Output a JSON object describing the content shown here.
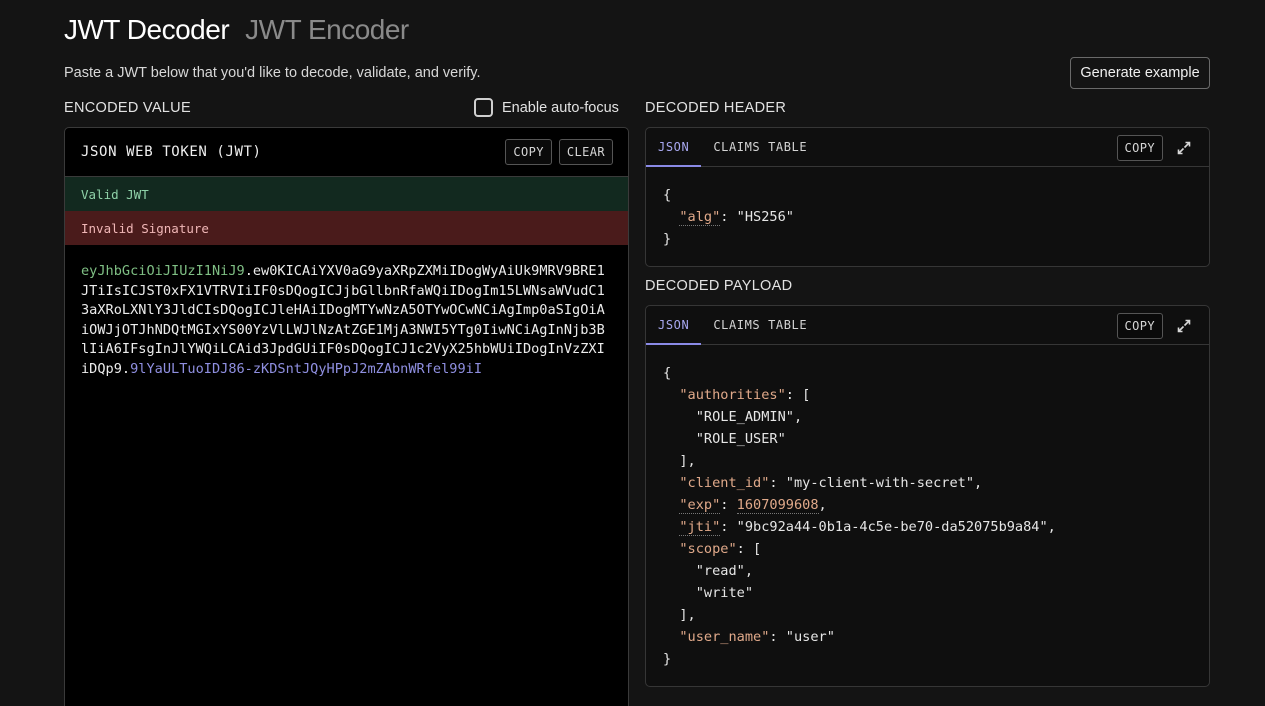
{
  "header": {
    "tab_decoder": "JWT Decoder",
    "tab_encoder": "JWT Encoder",
    "subtitle": "Paste a JWT below that you'd like to decode, validate, and verify.",
    "generate_label": "Generate example"
  },
  "left": {
    "section_label": "ENCODED VALUE",
    "autofocus_label": "Enable auto-focus",
    "panel_title": "JSON WEB TOKEN (JWT)",
    "copy_label": "COPY",
    "clear_label": "CLEAR",
    "status_valid": "Valid JWT",
    "status_invalid": "Invalid Signature",
    "token_header": "eyJhbGciOiJIUzI1NiJ9",
    "token_dot1": ".",
    "token_payload": "ew0KICAiYXV0aG9yaXRpZXMiIDogWyAiUk9MRV9BRE1JTiIsICJST0xFX1VTRVIiIF0sDQogICJjbGllbnRfaWQiIDogIm15LWNsaWVudC13aXRoLXNlY3JldCIsDQogICJleHAiIDogMTYwNzA5OTYwOCwNCiAgImp0aSIgOiAiOWJjOTJhNDQtMGIxYS00YzVlLWJlNzAtZGE1MjA3NWI5YTg0IiwNCiAgInNjb3BlIiA6IFsgInJlYWQiLCAid3JpdGUiIF0sDQogICJ1c2VyX25hbWUiIDogInVzZXIiDQp9",
    "token_dot2": ".",
    "token_signature": "9lYaULTuoIDJ86-zKDSntJQyHPpJ2mZAbnWRfel99iI"
  },
  "decoded_header": {
    "section_label": "DECODED HEADER",
    "tab_json": "JSON",
    "tab_claims": "CLAIMS TABLE",
    "copy_label": "COPY",
    "lines": {
      "open": "{",
      "alg_key": "\"alg\"",
      "alg_val": "\"HS256\"",
      "close": "}"
    }
  },
  "decoded_payload": {
    "section_label": "DECODED PAYLOAD",
    "tab_json": "JSON",
    "tab_claims": "CLAIMS TABLE",
    "copy_label": "COPY",
    "lines": {
      "open": "{",
      "authorities_key": "\"authorities\"",
      "role_admin": "\"ROLE_ADMIN\",",
      "role_user": "\"ROLE_USER\"",
      "arr_close1": "],",
      "client_id_key": "\"client_id\"",
      "client_id_val": "\"my-client-with-secret\",",
      "exp_key": "\"exp\"",
      "exp_val": "1607099608",
      "jti_key": "\"jti\"",
      "jti_val": "\"9bc92a44-0b1a-4c5e-be70-da52075b9a84\",",
      "scope_key": "\"scope\"",
      "read": "\"read\",",
      "write": "\"write\"",
      "arr_close2": "],",
      "user_name_key": "\"user_name\"",
      "user_name_val": "\"user\"",
      "close": "}"
    }
  }
}
